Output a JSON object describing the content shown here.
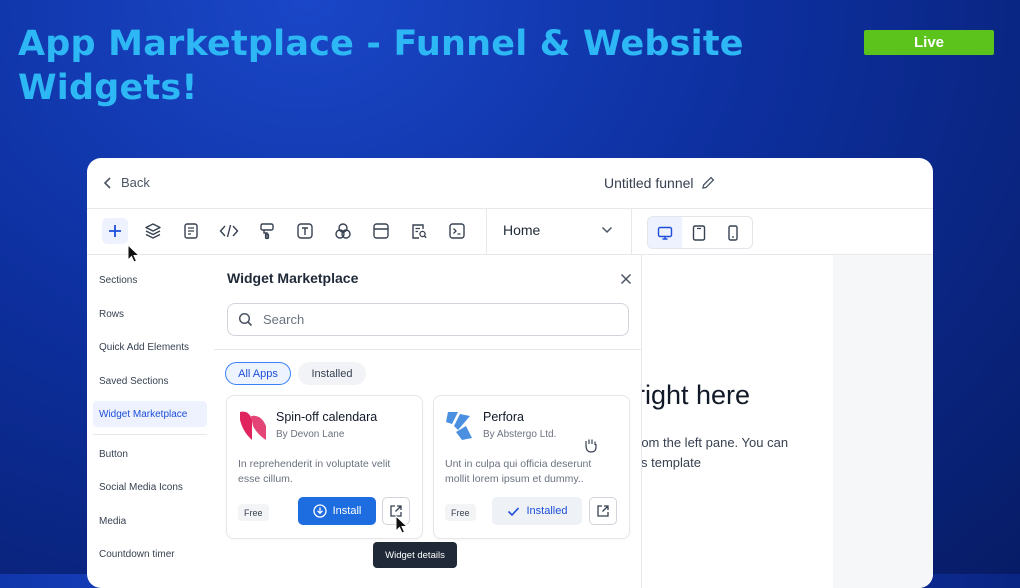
{
  "slide": {
    "title": "App Marketplace - Funnel & Website Widgets!",
    "badge": "Live"
  },
  "colors": {
    "title": "#2db8f5",
    "badge": "#5cc21c",
    "accent": "#1d6ce0"
  },
  "topbar": {
    "back_label": "Back",
    "funnel_title": "Untitled funnel"
  },
  "toolbar": {
    "tools": [
      "plus-icon",
      "layers-icon",
      "form-icon",
      "code-icon",
      "paint-roller-icon",
      "text-icon",
      "shapes-icon",
      "layout-icon",
      "search-doc-icon",
      "terminal-icon"
    ],
    "page_select": "Home",
    "devices": [
      "desktop-icon",
      "tablet-icon",
      "mobile-icon"
    ]
  },
  "sidebar": {
    "items": [
      {
        "label": "Sections"
      },
      {
        "label": "Rows"
      },
      {
        "label": "Quick Add Elements"
      },
      {
        "label": "Saved Sections"
      },
      {
        "label": "Widget Marketplace"
      },
      {
        "label": "Button"
      },
      {
        "label": "Social Media Icons"
      },
      {
        "label": "Media"
      },
      {
        "label": "Countdown timer"
      }
    ]
  },
  "marketplace": {
    "title": "Widget Marketplace",
    "search_placeholder": "Search",
    "filters": [
      "All Apps",
      "Installed"
    ],
    "cards": [
      {
        "name": "Spin-off calendara",
        "by": "By Devon Lane",
        "desc": "In reprehenderit in voluptate velit esse cillum.",
        "price": "Free",
        "action": "Install"
      },
      {
        "name": "Perfora",
        "by": "By Abstergo Ltd.",
        "desc": "Unt in culpa qui officia deserunt mollit lorem ipsum et dummy..",
        "price": "Free",
        "action": "Installed"
      }
    ],
    "tooltip": "Widget details"
  },
  "canvas": {
    "heading": "right here",
    "line1": "rom the left pane. You can",
    "line2": "s template"
  }
}
